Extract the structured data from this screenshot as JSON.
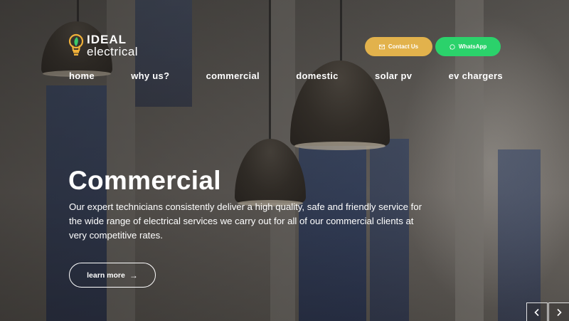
{
  "brand": {
    "name_line1": "IDEAL",
    "name_line2": "electrical",
    "bulb_color": "#f0b13a",
    "leaf_color": "#3cc96a"
  },
  "header": {
    "contact_label": "Contact Us",
    "contact_icon": "envelope-icon",
    "contact_color": "#e2b24c",
    "whatsapp_label": "WhatsApp",
    "whatsapp_icon": "whatsapp-icon",
    "whatsapp_color": "#2bd26b"
  },
  "nav": {
    "items": [
      {
        "label": "home"
      },
      {
        "label": "why us?"
      },
      {
        "label": "commercial"
      },
      {
        "label": "domestic"
      },
      {
        "label": "solar pv"
      },
      {
        "label": "ev chargers"
      }
    ]
  },
  "hero": {
    "title": "Commercial",
    "description": "Our expert technicians consistently deliver a high quality, safe and friendly service for the wide range of electrical services we carry out for all of our commercial clients at very competitive rates.",
    "cta_label": "learn more",
    "cta_icon": "arrow-right-icon"
  },
  "slider": {
    "prev_icon": "chevron-left-icon",
    "next_icon": "chevron-right-icon"
  }
}
